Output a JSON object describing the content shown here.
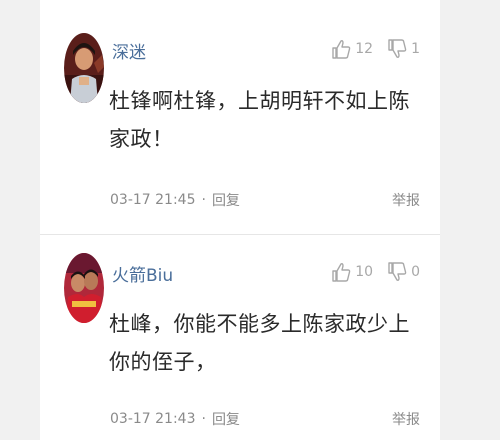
{
  "comments": [
    {
      "username": "深迷",
      "likes": "12",
      "dislikes": "1",
      "content": "杜锋啊杜锋，上胡明轩不如上陈家政！",
      "time": "03-17 21:45",
      "separator": "·",
      "reply": "回复",
      "report": "举报"
    },
    {
      "username": "火箭Biu",
      "likes": "10",
      "dislikes": "0",
      "content": "杜峰，你能不能多上陈家政少上你的侄子，",
      "time": "03-17 21:43",
      "separator": "·",
      "reply": "回复",
      "report": "举报"
    }
  ],
  "icons": {
    "like": "thumbs-up-icon",
    "dislike": "thumbs-down-icon"
  },
  "colors": {
    "username": "#4a6e9a",
    "muted": "#8a8a8a",
    "text": "#2a2a2a"
  }
}
